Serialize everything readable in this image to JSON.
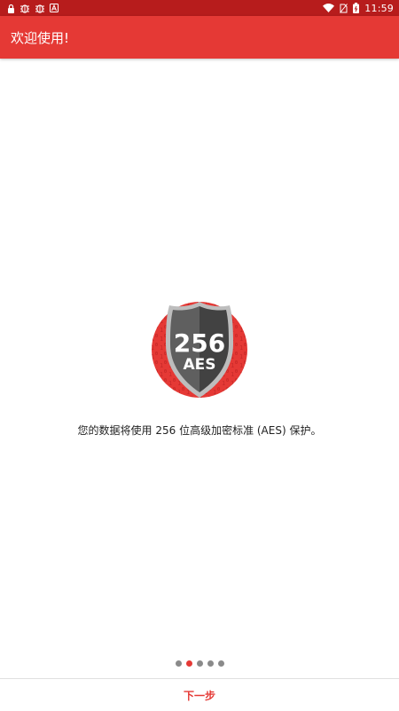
{
  "status_bar": {
    "time": "11:59",
    "left_icons": [
      "lock-icon",
      "bug-icon",
      "bug-icon",
      "a-icon"
    ],
    "right_icons": [
      "wifi-icon",
      "no-sim-icon",
      "battery-icon"
    ]
  },
  "app_bar": {
    "title": "欢迎使用!"
  },
  "hero": {
    "badge_number": "256",
    "badge_text": "AES",
    "icon": "shield-icon"
  },
  "message": "您的数据将使用 256 位高级加密标准 (AES) 保护。",
  "pager": {
    "count": 5,
    "active_index": 1
  },
  "next_label": "下一步",
  "colors": {
    "status_bar": "#b71c1c",
    "app_bar": "#e53935",
    "accent": "#e53935",
    "badge_circle": "#e53935"
  }
}
